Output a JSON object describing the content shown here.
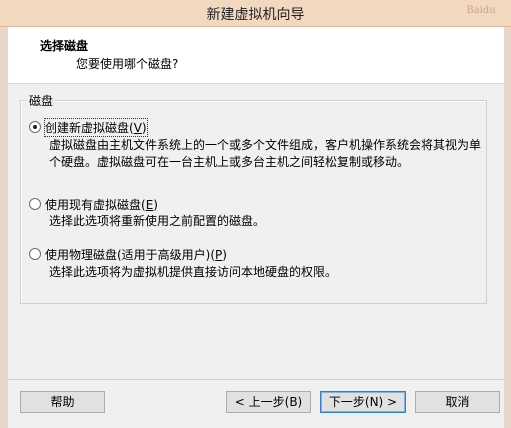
{
  "window": {
    "title": "新建虚拟机向导",
    "watermark": "Baidu"
  },
  "header": {
    "title": "选择磁盘",
    "subtitle": "您要使用哪个磁盘?"
  },
  "group": {
    "label": "磁盘"
  },
  "options": [
    {
      "label_prefix": "创建新虚拟磁盘(",
      "hotkey": "V",
      "label_suffix": ")",
      "selected": true,
      "desc_line1": "虚拟磁盘由主机文件系统上的一个或多个文件组成，客户机操作系统会将其视为单",
      "desc_line2": "个硬盘。虚拟磁盘可在一台主机上或多台主机之间轻松复制或移动。"
    },
    {
      "label_prefix": "使用现有虚拟磁盘(",
      "hotkey": "E",
      "label_suffix": ")",
      "selected": false,
      "desc_line1": "选择此选项将重新使用之前配置的磁盘。"
    },
    {
      "label_prefix": "使用物理磁盘(适用于高级用户)(",
      "hotkey": "P",
      "label_suffix": ")",
      "selected": false,
      "desc_line1": "选择此选项将为虚拟机提供直接访问本地硬盘的权限。"
    }
  ],
  "buttons": {
    "help": "帮助",
    "back": "< 上一步(B)",
    "next": "下一步(N) >",
    "cancel": "取消"
  }
}
